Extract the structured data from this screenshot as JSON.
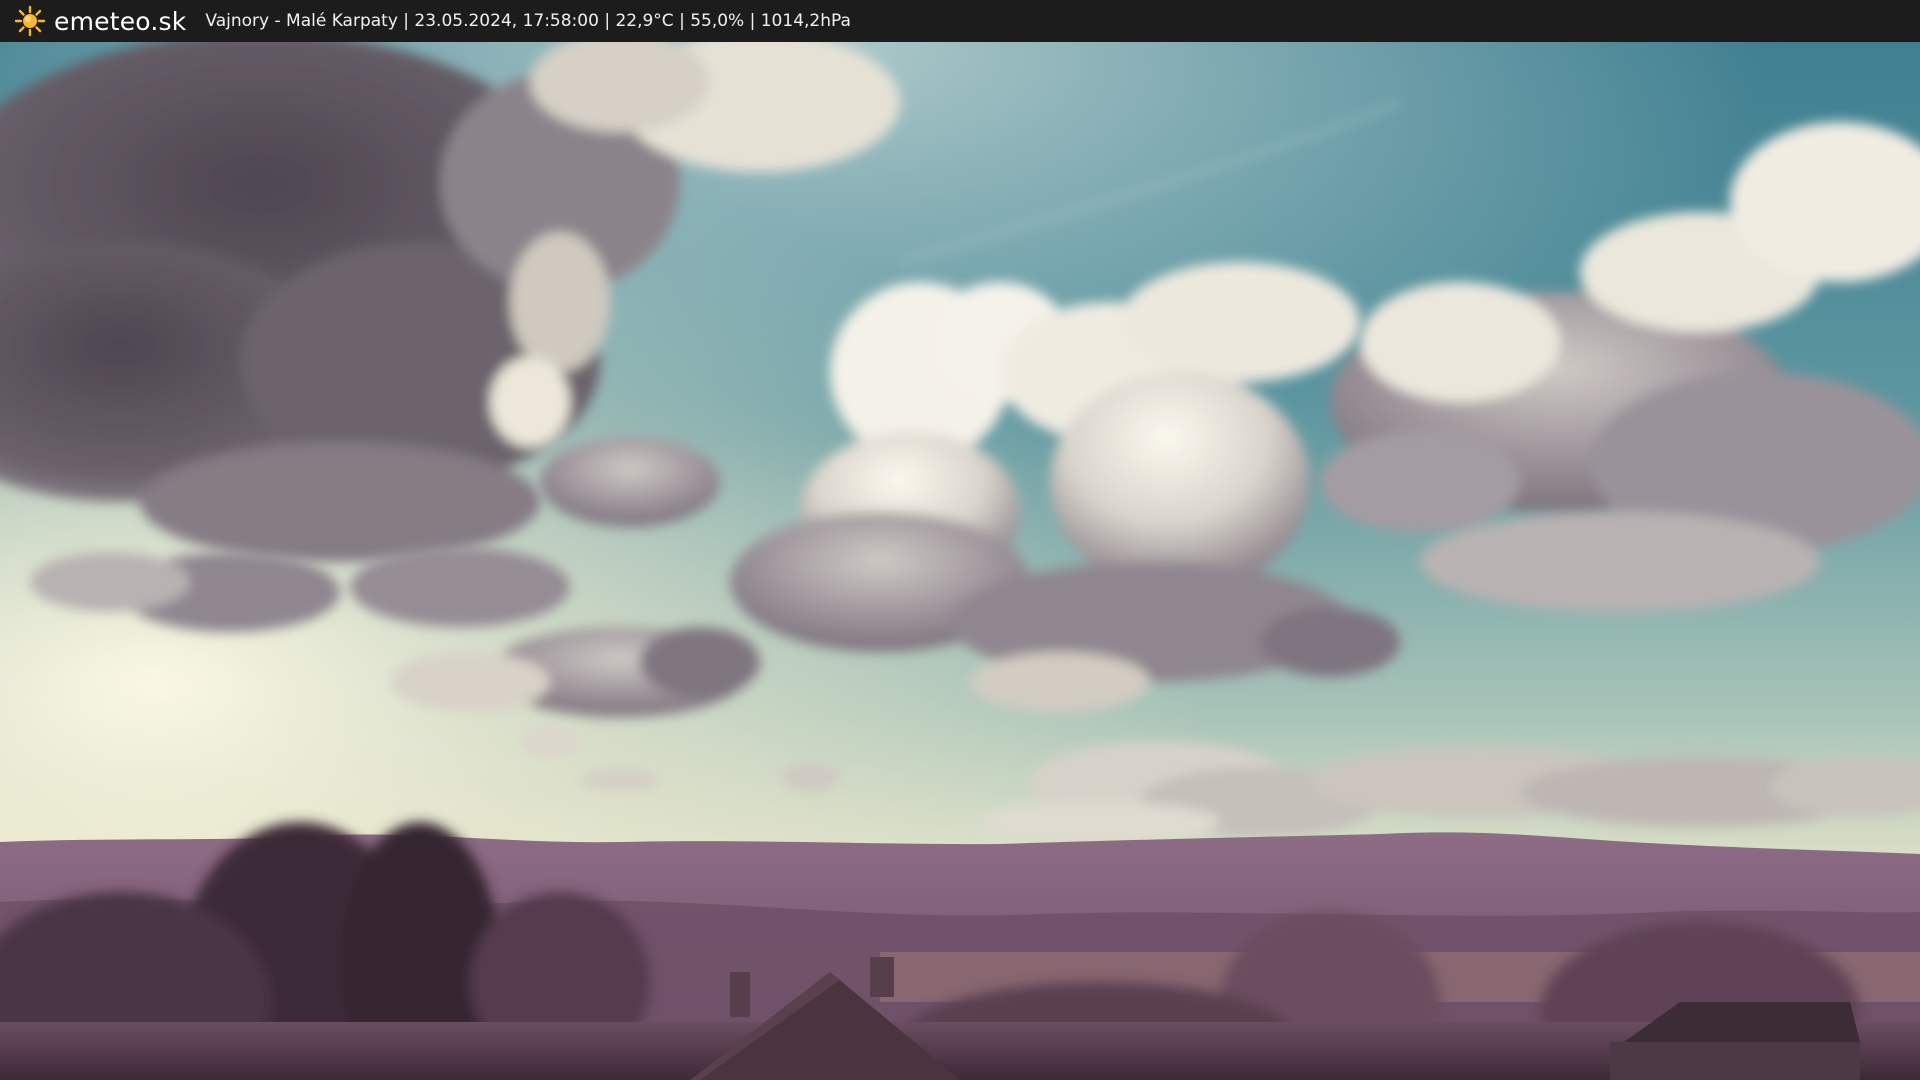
{
  "header": {
    "logo_icon": "sun-icon",
    "brand": "emeteo.sk",
    "caption": "Vajnory - Malé Karpaty | 23.05.2024, 17:58:00 | 22,9°C | 55,0% | 1014,2hPa"
  },
  "colors": {
    "topbar_background": "#1c1c1c",
    "sun": "#f7b733",
    "sky_blue": "#4d8a96",
    "horizon_glow": "#e8e6c8",
    "cloud_light": "#f1eee2",
    "cloud_dark": "#5c555e",
    "hills": "#7a5a73",
    "foliage": "#5a3f52"
  }
}
